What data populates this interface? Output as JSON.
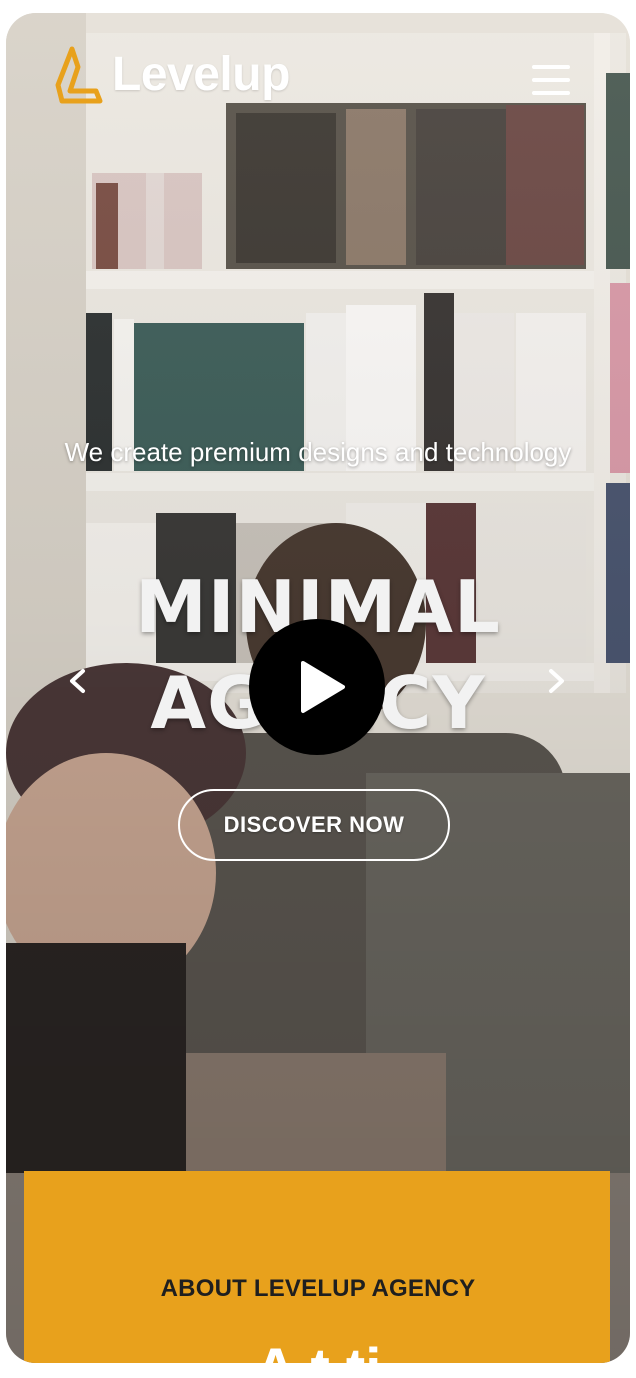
{
  "brand": {
    "name": "Levelup",
    "accent_color": "#e8a11c"
  },
  "header": {
    "menu_icon": "hamburger-menu-icon"
  },
  "hero": {
    "tagline": "We create premium designs and technology",
    "headline_line1": "MINIMAL",
    "headline_line2": "AGENCY",
    "cta_label": "DISCOVER NOW",
    "prev_icon": "chevron-left-icon",
    "next_icon": "chevron-right-icon",
    "play_icon": "play-icon"
  },
  "about": {
    "eyebrow": "ABOUT LEVELUP AGENCY",
    "heading_partial": "A t ti"
  }
}
